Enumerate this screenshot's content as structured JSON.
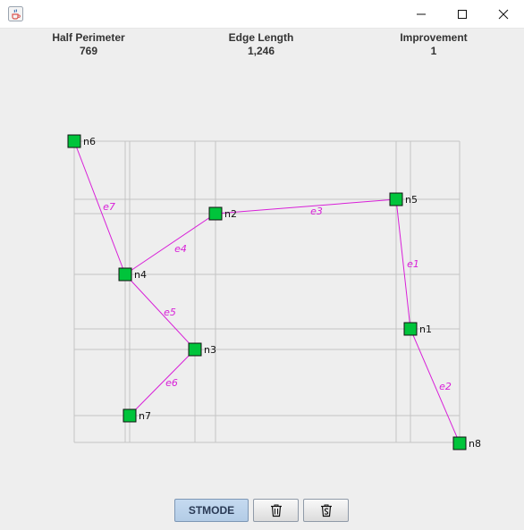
{
  "window": {
    "app_icon": "java-coffee-cup-icon",
    "controls": [
      "minimize-icon",
      "maximize-icon",
      "close-icon"
    ]
  },
  "stats": {
    "half_perimeter": {
      "label": "Half Perimeter",
      "value": "769"
    },
    "edge_length": {
      "label": "Edge Length",
      "value": "1,246"
    },
    "improvement": {
      "label": "Improvement",
      "value": "1"
    }
  },
  "graph": {
    "node_color": "#00c43b",
    "edge_color": "#d81fd8",
    "grid_color": "#c4c4c4",
    "nodes": [
      {
        "id": "n1",
        "label": "n1"
      },
      {
        "id": "n2",
        "label": "n2"
      },
      {
        "id": "n3",
        "label": "n3"
      },
      {
        "id": "n4",
        "label": "n4"
      },
      {
        "id": "n5",
        "label": "n5"
      },
      {
        "id": "n6",
        "label": "n6"
      },
      {
        "id": "n7",
        "label": "n7"
      },
      {
        "id": "n8",
        "label": "n8"
      }
    ],
    "edges": [
      {
        "id": "e1",
        "label": "e1",
        "from": "n5",
        "to": "n1"
      },
      {
        "id": "e2",
        "label": "e2",
        "from": "n1",
        "to": "n8"
      },
      {
        "id": "e3",
        "label": "e3",
        "from": "n2",
        "to": "n5"
      },
      {
        "id": "e4",
        "label": "e4",
        "from": "n4",
        "to": "n2"
      },
      {
        "id": "e5",
        "label": "e5",
        "from": "n4",
        "to": "n3"
      },
      {
        "id": "e6",
        "label": "e6",
        "from": "n3",
        "to": "n7"
      },
      {
        "id": "e7",
        "label": "e7",
        "from": "n6",
        "to": "n4"
      }
    ]
  },
  "toolbar": {
    "stmode_label": "STMODE",
    "delete_icon": "trash-icon",
    "clear_icon": "trash-with-s-icon"
  }
}
